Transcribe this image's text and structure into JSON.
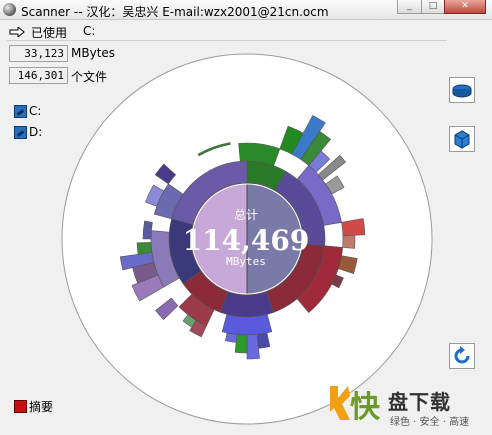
{
  "window": {
    "title": "Scanner -- 汉化：吴忠兴  E-mail:wzx2001@21cn.ocm",
    "minimize": "_",
    "maximize": "□",
    "close": "✕"
  },
  "toolbar": {
    "used_label": "已使用",
    "drive": "C:"
  },
  "stats": {
    "size_value": "33,123",
    "size_unit": "MBytes",
    "files_value": "146,301",
    "files_unit": "个文件"
  },
  "drives": [
    {
      "label": "C:"
    },
    {
      "label": "D:"
    }
  ],
  "center": {
    "label": "总计",
    "value": "114,469",
    "unit": "MBytes"
  },
  "summary_label": "摘要",
  "watermark": {
    "char": "快",
    "title": "盘下载",
    "subtitle": "绿色 · 安全 · 高速"
  },
  "colors": {
    "ring_a": "#c8a8d8",
    "ring_b": "#7a7aa8",
    "purple": "#5a4a9a",
    "dark_red": "#8a2a3a",
    "green": "#208a20",
    "blue": "#5a5adc"
  },
  "icons": [
    "arrow-right-icon",
    "drive-icon",
    "cube-icon",
    "refresh-icon",
    "summary-icon"
  ]
}
